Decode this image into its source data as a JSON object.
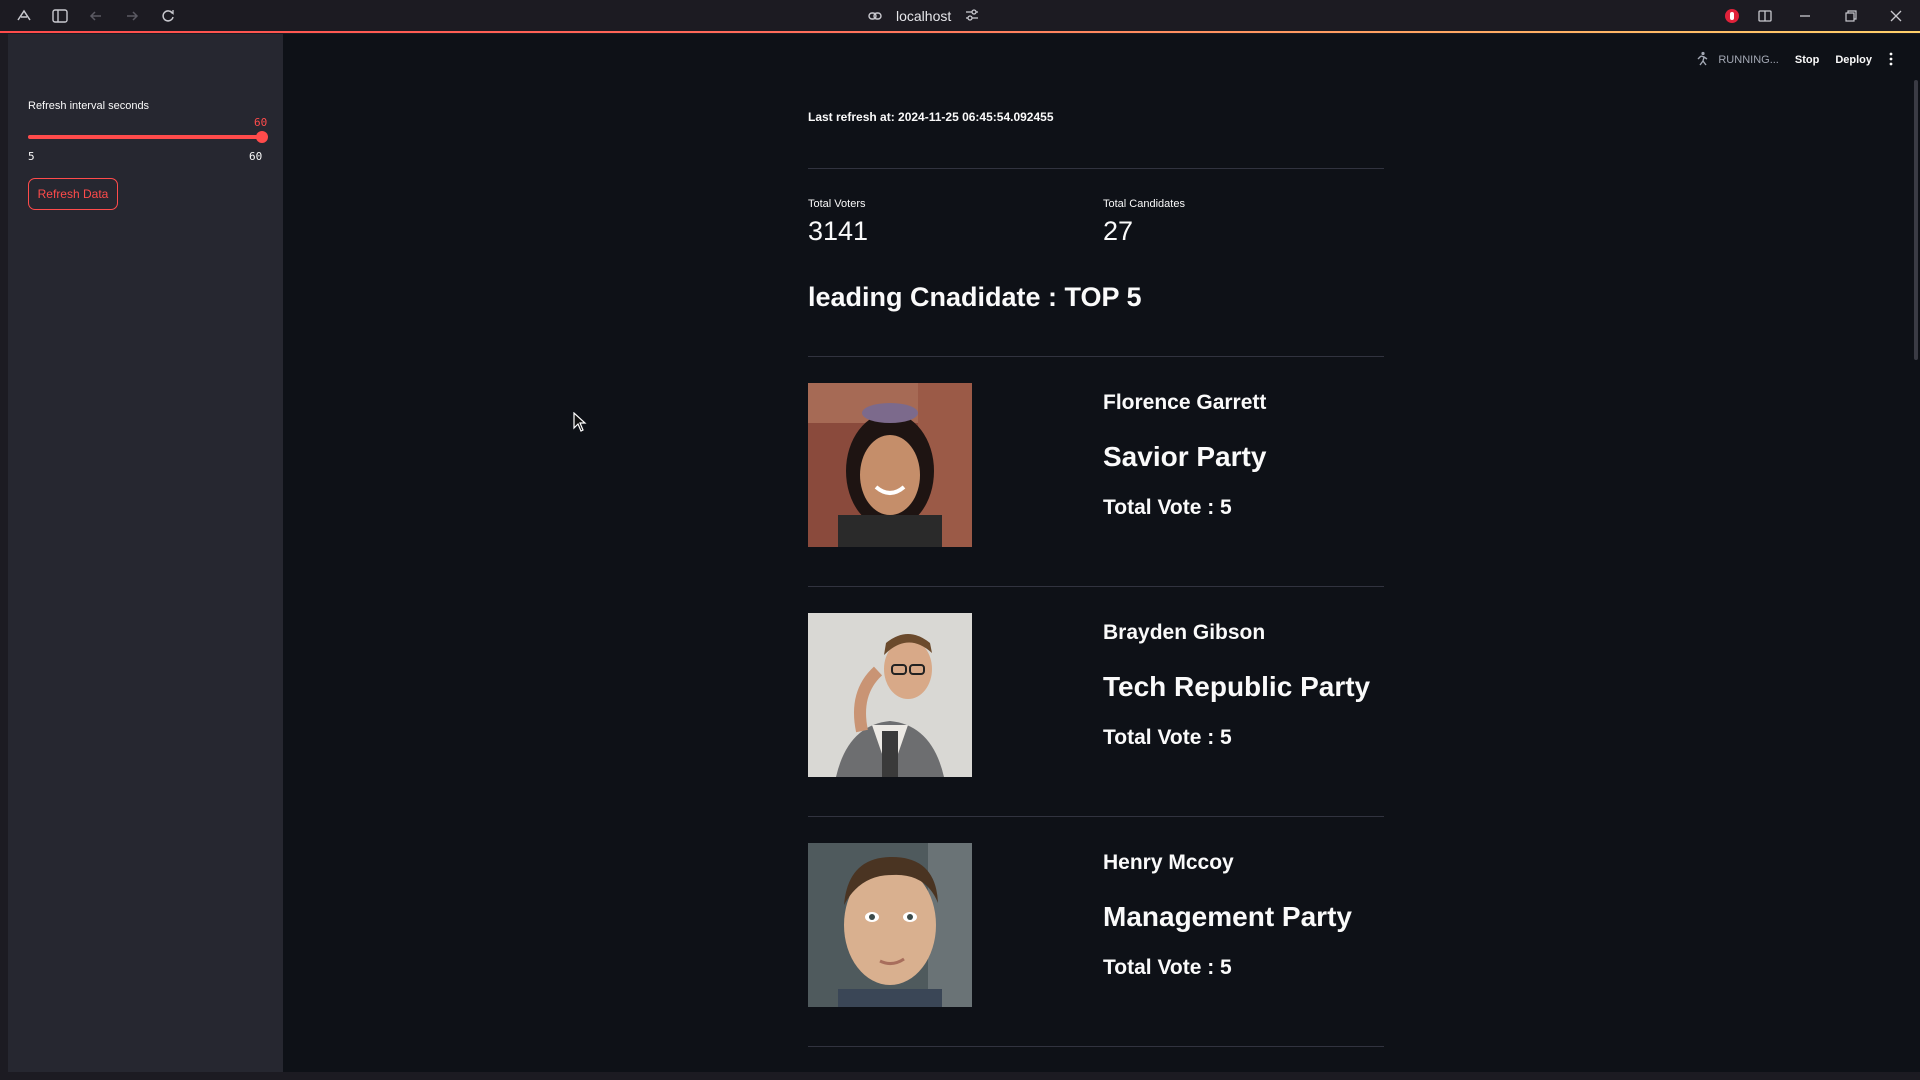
{
  "browser": {
    "url": "localhost"
  },
  "header": {
    "status": "RUNNING...",
    "stop_label": "Stop",
    "deploy_label": "Deploy"
  },
  "sidebar": {
    "slider": {
      "label": "Refresh interval seconds",
      "value": "60",
      "min": "5",
      "max": "60",
      "fraction": 1.0
    },
    "refresh_button": "Refresh Data"
  },
  "main": {
    "last_refresh": "Last refresh at: 2024-11-25 06:45:54.092455",
    "metrics": [
      {
        "label": "Total Voters",
        "value": "3141"
      },
      {
        "label": "Total Candidates",
        "value": "27"
      }
    ],
    "section_title": "leading Cnadidate : TOP 5",
    "candidates": [
      {
        "name": "Florence Garrett",
        "party": "Savior Party",
        "votes": "Total Vote : 5",
        "photo_bg": "#8a4a3c",
        "skin": "#c58e6a",
        "hair": "#1e1412",
        "shirt": "#2a2a2a"
      },
      {
        "name": "Brayden Gibson",
        "party": "Tech Republic Party",
        "votes": "Total Vote : 5",
        "photo_bg": "#d9d8d4",
        "skin": "#d8a988",
        "hair": "#6b4a2c",
        "shirt": "#6d6e70"
      },
      {
        "name": "Henry Mccoy",
        "party": "Management Party",
        "votes": "Total Vote : 5",
        "photo_bg": "#4f5a5d",
        "skin": "#d9b08f",
        "hair": "#4a3422",
        "shirt": "#3a4656"
      }
    ]
  },
  "colors": {
    "accent": "#ff4b4b",
    "app_bg": "#0e1117",
    "sidebar_bg": "#262730"
  }
}
